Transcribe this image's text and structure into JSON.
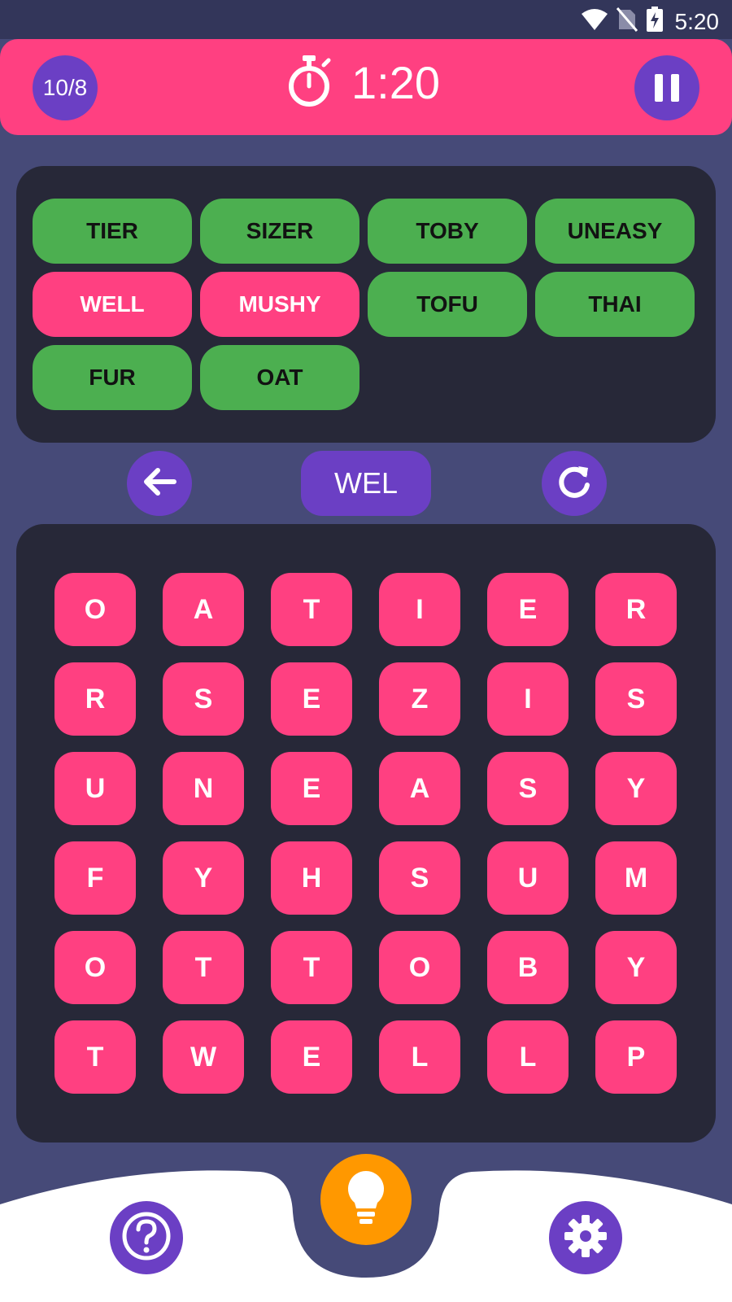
{
  "status_bar": {
    "time": "5:20",
    "icons": [
      "wifi-icon",
      "no-sim-icon",
      "battery-charging-icon"
    ]
  },
  "header": {
    "level_progress": "10/8",
    "timer": "1:20",
    "icons": [
      "stopwatch-icon",
      "pause-icon"
    ]
  },
  "words": [
    {
      "text": "TIER",
      "found": true
    },
    {
      "text": "SIZER",
      "found": true
    },
    {
      "text": "TOBY",
      "found": true
    },
    {
      "text": "UNEASY",
      "found": true
    },
    {
      "text": "WELL",
      "found": false
    },
    {
      "text": "MUSHY",
      "found": false
    },
    {
      "text": "TOFU",
      "found": true
    },
    {
      "text": "THAI",
      "found": true
    },
    {
      "text": "FUR",
      "found": true
    },
    {
      "text": "OAT",
      "found": true
    }
  ],
  "controls": {
    "current_word": "WEL",
    "icons": [
      "back-arrow-icon",
      "refresh-icon"
    ]
  },
  "grid": [
    [
      "O",
      "A",
      "T",
      "I",
      "E",
      "R"
    ],
    [
      "R",
      "S",
      "E",
      "Z",
      "I",
      "S"
    ],
    [
      "U",
      "N",
      "E",
      "A",
      "S",
      "Y"
    ],
    [
      "F",
      "Y",
      "H",
      "S",
      "U",
      "M"
    ],
    [
      "O",
      "T",
      "T",
      "O",
      "B",
      "Y"
    ],
    [
      "T",
      "W",
      "E",
      "L",
      "L",
      "P"
    ]
  ],
  "bottom_bar": {
    "icons": [
      "help-icon",
      "lightbulb-icon",
      "settings-icon"
    ]
  },
  "colors": {
    "background": "#464a78",
    "panel": "#272838",
    "accent_pink": "#ff4081",
    "accent_purple": "#6b3fc4",
    "found_green": "#4caf50",
    "hint_orange": "#ff9800"
  }
}
